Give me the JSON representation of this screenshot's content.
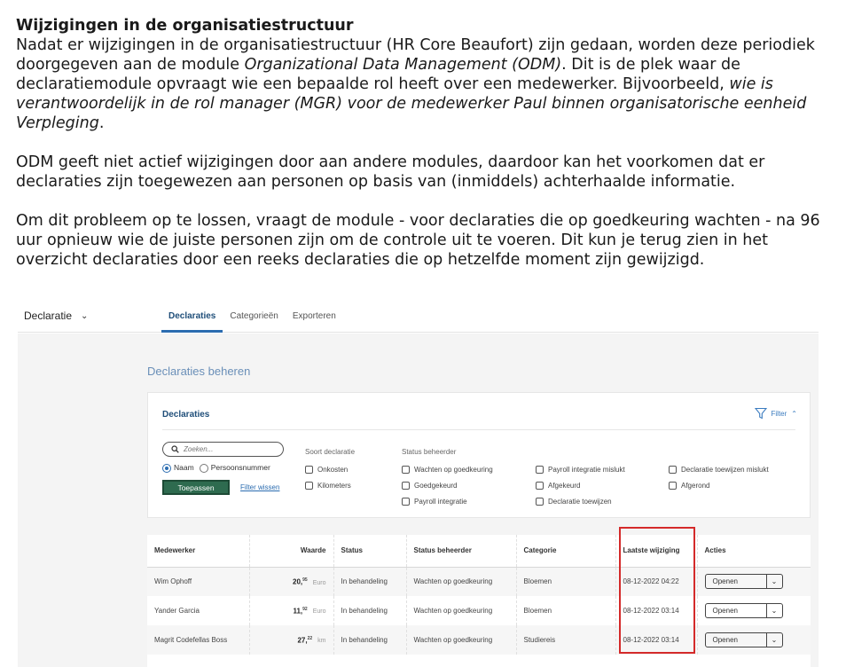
{
  "article": {
    "heading": "Wijzigingen in de organisatiestructuur",
    "p1_a": "Nadat er wijzigingen in de organisatiestructuur (HR Core Beaufort) zijn gedaan, worden deze periodiek doorgegeven aan de module ",
    "p1_em": "Organizational Data Management (ODM)",
    "p1_b": ". Dit is de plek waar de declaratiemodule opvraagt wie een bepaalde rol heeft over een medewerker. Bijvoorbeeld, ",
    "p1_em2": "wie is verantwoordelijk in de rol manager (MGR) voor de medewerker Paul binnen organisatorische eenheid Verpleging",
    "p1_c": ".",
    "p2": "ODM geeft niet actief wijzigingen door aan andere modules, daardoor kan het voorkomen dat er declaraties zijn toegewezen aan personen op basis van (inmiddels) achterhaalde informatie.",
    "p3": "Om dit probleem op te lossen, vraagt de module - voor declaraties die op goedkeuring wachten - na 96 uur opnieuw wie de juiste personen zijn om de controle uit te voeren. Dit kun je terug zien in het overzicht declaraties door een reeks declaraties die op hetzelfde moment zijn gewijzigd."
  },
  "app": {
    "module_select": "Declaratie",
    "tabs": [
      "Declaraties",
      "Categorieën",
      "Exporteren"
    ],
    "active_tab": 0,
    "page_title": "Declaraties beheren",
    "filter_card": {
      "title": "Declaraties",
      "toggle_label": "Filter",
      "search_placeholder": "Zoeken...",
      "radio_options": [
        "Naam",
        "Persoonsnummer"
      ],
      "radio_selected": "Naam",
      "apply_label": "Toepassen",
      "clear_label": "Filter wissen",
      "group_soort": "Soort declaratie",
      "soort_options": [
        "Onkosten",
        "Kilometers"
      ],
      "group_status": "Status beheerder",
      "status_options": [
        "Wachten op goedkeuring",
        "Goedgekeurd",
        "Payroll integratie",
        "Payroll integratie mislukt",
        "Afgekeurd",
        "Declaratie toewijzen",
        "Declaratie toewijzen mislukt",
        "Afgerond"
      ]
    },
    "table": {
      "headers": [
        "Medewerker",
        "Waarde",
        "Status",
        "Status beheerder",
        "Categorie",
        "Laatste wijziging",
        "Acties"
      ],
      "rows": [
        {
          "medewerker": "Wim Ophoff",
          "waarde_int": "20,",
          "waarde_dec": "95",
          "unit": "Euro",
          "status": "In behandeling",
          "status_beheerder": "Wachten op goedkeuring",
          "categorie": "Bloemen",
          "laatste_wijziging": "08-12-2022 04:22",
          "actie": "Openen"
        },
        {
          "medewerker": "Yander Garcia",
          "waarde_int": "11,",
          "waarde_dec": "92",
          "unit": "Euro",
          "status": "In behandeling",
          "status_beheerder": "Wachten op goedkeuring",
          "categorie": "Bloemen",
          "laatste_wijziging": "08-12-2022 03:14",
          "actie": "Openen"
        },
        {
          "medewerker": "Magrit Codefellas Boss",
          "waarde_int": "27,",
          "waarde_dec": "22",
          "unit": "km",
          "status": "In behandeling",
          "status_beheerder": "Wachten op goedkeuring",
          "categorie": "Studiereis",
          "laatste_wijziging": "08-12-2022 03:14",
          "actie": "Openen"
        }
      ]
    },
    "colors": {
      "accent": "#2b6cb0",
      "apply_button": "#2e6b4f",
      "highlight": "#d42a2a"
    }
  }
}
